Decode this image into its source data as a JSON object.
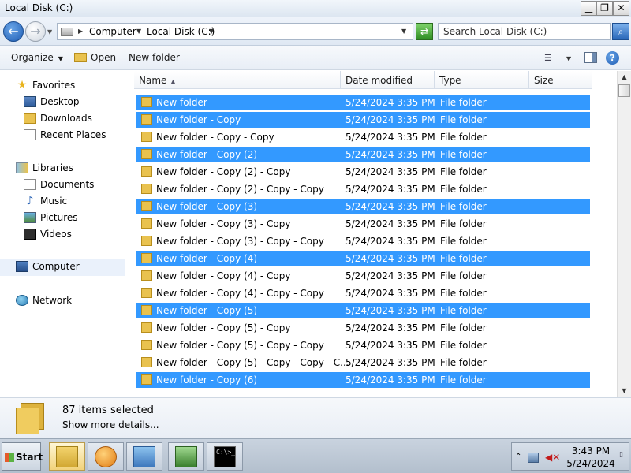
{
  "window": {
    "title": "Local Disk (C:)",
    "minimize": "▁",
    "maximize": "❐",
    "close": "✕"
  },
  "address": {
    "crumbs": [
      "Computer",
      "Local Disk (C:)"
    ],
    "search_placeholder": "Search Local Disk (C:)"
  },
  "toolbar": {
    "organize": "Organize",
    "open": "Open",
    "new_folder": "New folder"
  },
  "nav": {
    "favorites": "Favorites",
    "desktop": "Desktop",
    "downloads": "Downloads",
    "recent": "Recent Places",
    "libraries": "Libraries",
    "documents": "Documents",
    "music": "Music",
    "pictures": "Pictures",
    "videos": "Videos",
    "computer": "Computer",
    "network": "Network"
  },
  "columns": {
    "name": "Name",
    "date": "Date modified",
    "type": "Type",
    "size": "Size"
  },
  "rows": [
    {
      "name": "New folder",
      "date": "5/24/2024 3:35 PM",
      "type": "File folder",
      "selected": true
    },
    {
      "name": "New folder - Copy",
      "date": "5/24/2024 3:35 PM",
      "type": "File folder",
      "selected": true
    },
    {
      "name": "New folder - Copy - Copy",
      "date": "5/24/2024 3:35 PM",
      "type": "File folder",
      "selected": false
    },
    {
      "name": "New folder - Copy (2)",
      "date": "5/24/2024 3:35 PM",
      "type": "File folder",
      "selected": true
    },
    {
      "name": "New folder - Copy (2) - Copy",
      "date": "5/24/2024 3:35 PM",
      "type": "File folder",
      "selected": false
    },
    {
      "name": "New folder - Copy (2) - Copy - Copy",
      "date": "5/24/2024 3:35 PM",
      "type": "File folder",
      "selected": false
    },
    {
      "name": "New folder - Copy (3)",
      "date": "5/24/2024 3:35 PM",
      "type": "File folder",
      "selected": true
    },
    {
      "name": "New folder - Copy (3) - Copy",
      "date": "5/24/2024 3:35 PM",
      "type": "File folder",
      "selected": false
    },
    {
      "name": "New folder - Copy (3) - Copy - Copy",
      "date": "5/24/2024 3:35 PM",
      "type": "File folder",
      "selected": false
    },
    {
      "name": "New folder - Copy (4)",
      "date": "5/24/2024 3:35 PM",
      "type": "File folder",
      "selected": true
    },
    {
      "name": "New folder - Copy (4) - Copy",
      "date": "5/24/2024 3:35 PM",
      "type": "File folder",
      "selected": false
    },
    {
      "name": "New folder - Copy (4) - Copy - Copy",
      "date": "5/24/2024 3:35 PM",
      "type": "File folder",
      "selected": false
    },
    {
      "name": "New folder - Copy (5)",
      "date": "5/24/2024 3:35 PM",
      "type": "File folder",
      "selected": true
    },
    {
      "name": "New folder - Copy (5) - Copy",
      "date": "5/24/2024 3:35 PM",
      "type": "File folder",
      "selected": false
    },
    {
      "name": "New folder - Copy (5) - Copy - Copy",
      "date": "5/24/2024 3:35 PM",
      "type": "File folder",
      "selected": false
    },
    {
      "name": "New folder - Copy (5) - Copy - Copy - C...",
      "date": "5/24/2024 3:35 PM",
      "type": "File folder",
      "selected": false
    },
    {
      "name": "New folder - Copy (6)",
      "date": "5/24/2024 3:35 PM",
      "type": "File folder",
      "selected": true
    }
  ],
  "details": {
    "count": "87 items selected",
    "more": "Show more details..."
  },
  "taskbar": {
    "start": "Start",
    "cmd_text": "C:\\>_",
    "time": "3:43 PM",
    "date": "5/24/2024"
  },
  "colors": {
    "selection": "#3399ff",
    "folder": "#e9c24f"
  }
}
